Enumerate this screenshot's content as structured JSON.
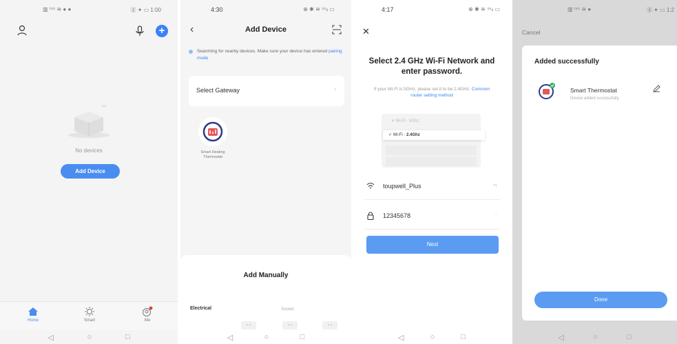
{
  "screen1": {
    "status_left": "▥ ᵗ⁴⁶ ≋ ● ●",
    "status_right": "ⓖ ✦ ▭ 1:00",
    "empty_text": "No devices",
    "add_device_button": "Add Device",
    "tabs": [
      {
        "label": "Home",
        "icon": "home-icon"
      },
      {
        "label": "Smart",
        "icon": "sun-icon"
      },
      {
        "label": "Me",
        "icon": "user-badge-icon"
      }
    ]
  },
  "screen2": {
    "status_time": "4:30",
    "status_right": "⊕ ✱ ≋ ⁵⁶ᵢₗ ▭",
    "title": "Add Device",
    "search_note": "Searching for nearby devices. Make sure your device has entered ",
    "search_link": "pairing mode",
    "gateway_label": "Select Gateway",
    "found_device": "Smart Heating Thermostat",
    "manual_title": "Add Manually",
    "category_electrical": "Electrical",
    "category_socket": "Socket",
    "mini_glyph": "▫ ▫"
  },
  "screen3": {
    "status_time": "4:17",
    "status_right": "⊕ ✱ ≋ ⁴⁶ᵢₗ ▭",
    "title": "Select 2.4 GHz Wi-Fi Network and enter password.",
    "subtitle": "If your Wi-Fi is 5GHz, please set it to be 2.4GHz. ",
    "subtitle_link": "Common router setting method",
    "wifi_5g": "✕ Wi-Fi · 5Ghz",
    "wifi_24_prefix": "✓ Wi-Fi · ",
    "wifi_24": "2.4Ghz",
    "ssid": "toupwell_Plus",
    "ssid_hint": "⇆",
    "password": "12345678",
    "pw_hint": "◌",
    "next_button": "Next"
  },
  "screen4": {
    "status_left": "▥ ᵗ⁴⁶ ≋ ●",
    "status_right": "ⓖ ✦ ▭ 1:2",
    "cancel": "Cancel",
    "added_title": "Added successfully",
    "device_name": "Smart Thermostat",
    "device_status": "Device added successfully",
    "done_button": "Done"
  },
  "sysnav": {
    "back": "◁",
    "home": "○",
    "recent": "□"
  }
}
